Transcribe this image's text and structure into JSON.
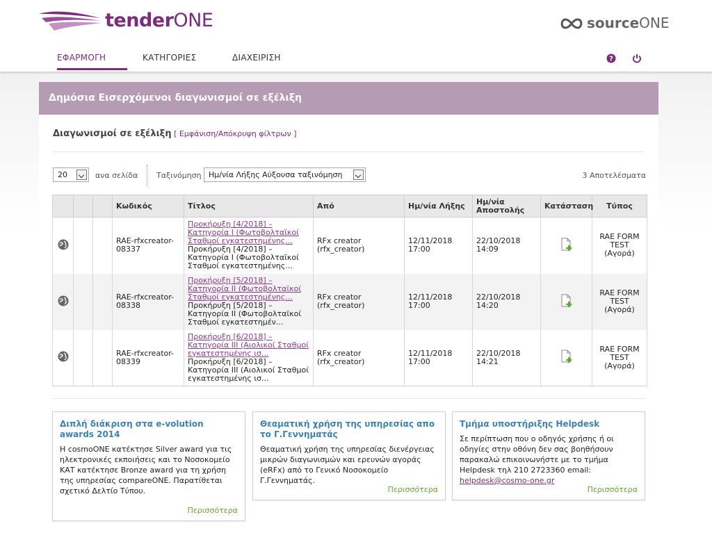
{
  "brand": {
    "name_bold": "tender",
    "name_light": "ONE",
    "partner_bold": "source",
    "partner_light": "ONE",
    "accent": "#7b2d7b"
  },
  "nav": {
    "items": [
      {
        "label": "ΕΦΑΡΜΟΓΗ",
        "active": true
      },
      {
        "label": "ΚΑΤΗΓΟΡΙΕΣ"
      },
      {
        "label": "ΔΙΑΧΕΙΡΙΣΗ"
      }
    ]
  },
  "header_icons": [
    "help-icon",
    "power-icon"
  ],
  "panel": {
    "title": "Δημόσια Εισερχόμενοι διαγωνισμοί σε εξέλιξη",
    "subtitle": "Διαγωνισμοί σε εξέλιξη",
    "filter_link": "[ Εμφάνιση/Απόκρυψη φίλτρων ]"
  },
  "controls": {
    "per_page_value": "20",
    "per_page_label": "ανα σελίδα",
    "sort_label": "Ταξινόμηση",
    "sort_value": "Ημ/νία Λήξης Αύξουσα ταξινόμηση",
    "results": "3 Αποτελέσματα"
  },
  "table": {
    "headers": [
      "",
      "",
      "",
      "Κωδικός",
      "Τίτλος",
      "Από",
      "Ημ/νία Λήξης",
      "Ημ/νία Αποστολής",
      "Κατάσταση",
      "Τύπος"
    ],
    "rows": [
      {
        "code": "RAE-rfxcreator-08337",
        "title_link": "Προκήρυξη [4/2018] – Κατηγορία I (Φωτοβολταϊκοί Σταθμοί εγκατεστημένης...",
        "title_desc": "Προκήρυξη [4/2018] – Κατηγορία I (Φωτοβολταϊκοί Σταθμοί εγκατεστημένης...",
        "from": "RFx creator (rfx_creator)",
        "deadline": "12/11/2018 17:00",
        "sent": "22/10/2018 14:09",
        "type": "RAE FORM TEST (Αγορά)"
      },
      {
        "code": "RAE-rfxcreator-08338",
        "title_link": "Προκήρυξη [5/2018] – Κατηγορία II (Φωτοβολταϊκοί Σταθμοί εγκατεστημένης...",
        "title_desc": "Προκήρυξη [5/2018] – Κατηγορία II (Φωτοβολταϊκοί Σταθμοί εγκατεστημέν...",
        "from": "RFx creator (rfx_creator)",
        "deadline": "12/11/2018 17:00",
        "sent": "22/10/2018 14:20",
        "type": "RAE FORM TEST (Αγορά)"
      },
      {
        "code": "RAE-rfxcreator-08339",
        "title_link": "Προκήρυξη [6/2018] – Κατηγορία III (Αιολικοί Σταθμοί εγκατεστημένης ισ...",
        "title_desc": "Προκήρυξη [6/2018] – Κατηγορία III (Αιολικοί Σταθμοί εγκατεστημένης ισ...",
        "from": "RFx creator (rfx_creator)",
        "deadline": "12/11/2018 17:00",
        "sent": "22/10/2018 14:21",
        "type": "RAE FORM TEST (Αγορά)"
      }
    ]
  },
  "news": [
    {
      "title": "Διπλή διάκριση στα e-volution awards 2014",
      "body": "Η cosmoONE κατέκτησε Silver award για τις ηλεκτρονικές εκποιήσεις και το Νοσοκομείο ΚΑΤ κατέκτησε Bronze award για τη χρήση της υπηρεσίας compareONE. Παρατίθεται σχετικό Δελτίο Τύπου.",
      "more": "Περισσότερα"
    },
    {
      "title": "Θεαματική χρήση της υπηρεσίας απο το Γ.Γεννηματάς",
      "body": "Θεαματική χρήση της υπηρεσίας διενέργειας μικρών διαγωνισμών και ερευνών αγοράς (eRFx) από το Γενικό Νοσοκομείο Γ.Γεννηματάς.",
      "more": "Περισσότερα"
    },
    {
      "title": "Τμήμα υποστήριξης Helpdesk",
      "body": "Σε περίπτωση που ο οδηγός χρήσης ή οι οδηγίες στην οθόνη δεν σας βοηθήσουν παρακαλώ επικοινωνήστε με το τμήμα Helpdesk τηλ 210 2723360 email:",
      "email": "helpdesk@cosmo-one.gr",
      "more": "Περισσότερα"
    }
  ]
}
